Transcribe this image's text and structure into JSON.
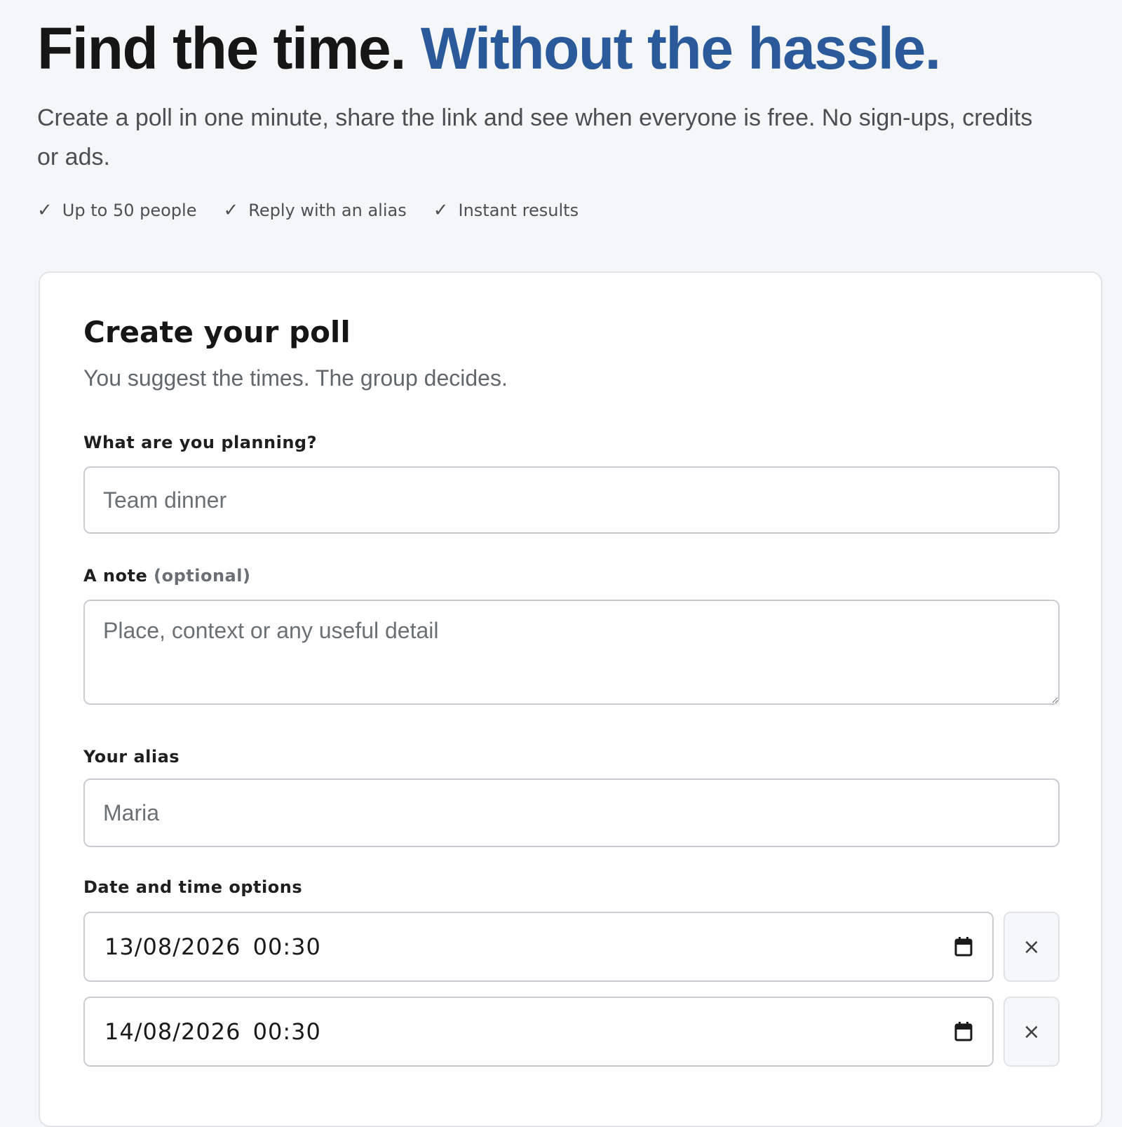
{
  "hero": {
    "title_main": "Find the time.",
    "title_accent": "Without the hassle.",
    "subtitle": "Create a poll in one minute, share the link and see when everyone is free. No sign-ups, credits or ads.",
    "features": [
      {
        "icon": "check-icon",
        "label": "Up to 50 people"
      },
      {
        "icon": "check-icon",
        "label": "Reply with an alias"
      },
      {
        "icon": "check-icon",
        "label": "Instant results"
      }
    ],
    "check_glyph": "✓"
  },
  "form": {
    "title": "Create your poll",
    "subtitle": "You suggest the times. The group decides.",
    "planning": {
      "label": "What are you planning?",
      "placeholder": "Team dinner",
      "value": ""
    },
    "note": {
      "label": "A note",
      "label_optional": "(optional)",
      "placeholder": "Place, context or any useful detail",
      "value": ""
    },
    "alias": {
      "label": "Your alias",
      "placeholder": "Maria",
      "value": ""
    },
    "date_options": {
      "label": "Date and time options",
      "items": [
        {
          "value": "13/08/2026  00:30",
          "remove_label": "×"
        },
        {
          "value": "14/08/2026  00:30",
          "remove_label": "×"
        }
      ]
    }
  },
  "colors": {
    "accent": "#2a5a9a",
    "background": "#f5f6f8",
    "card": "#ffffff"
  }
}
